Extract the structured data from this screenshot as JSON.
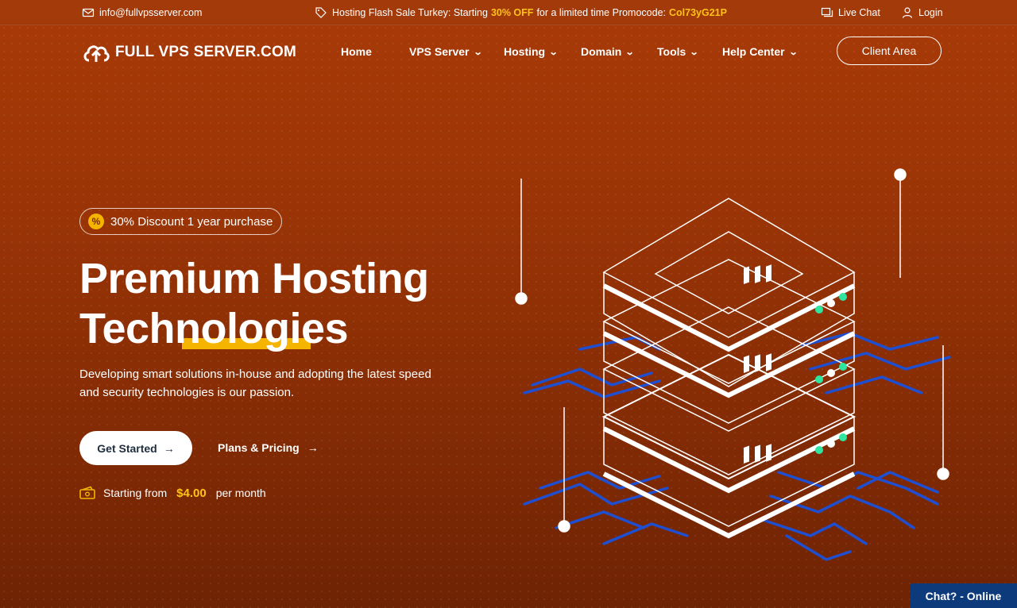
{
  "topbar": {
    "email": "info@fullvpsserver.com",
    "promo_prefix": "Hosting Flash Sale Turkey: Starting",
    "promo_discount": "30% OFF",
    "promo_middle": "for a limited time Promocode:",
    "promo_code": "Col73yG21P",
    "live_chat": "Live Chat",
    "login": "Login"
  },
  "nav": {
    "logo_text": "FULL VPS SERVER.COM",
    "items": [
      {
        "label": "Home",
        "dropdown": false
      },
      {
        "label": "VPS Server",
        "dropdown": true
      },
      {
        "label": "Hosting",
        "dropdown": true
      },
      {
        "label": "Domain",
        "dropdown": true
      },
      {
        "label": "Tools",
        "dropdown": true
      },
      {
        "label": "Help Center",
        "dropdown": true
      }
    ],
    "client_area": "Client Area"
  },
  "hero": {
    "badge": "30% Discount 1 year purchase",
    "title_line1": "Premium Hosting",
    "title_line2": "Technologies",
    "description": "Developing smart solutions in-house and adopting the latest speed and security technologies is our passion.",
    "get_started": "Get Started",
    "plans_pricing": "Plans & Pricing",
    "starting_from": "Starting from",
    "price": "$4.00",
    "per_month": "per month"
  },
  "chat_widget": "Chat? - Online",
  "colors": {
    "accent": "#ffc21a",
    "background": "#9a3406",
    "chat": "#0d3a7a",
    "circuit": "#1f4fd1"
  },
  "icons": [
    "mail-icon",
    "tag-icon",
    "chat-icon",
    "user-icon",
    "cloud-upload-icon",
    "percent-coin-icon",
    "arrow-right-icon",
    "money-icon",
    "server-stack-illustration"
  ]
}
